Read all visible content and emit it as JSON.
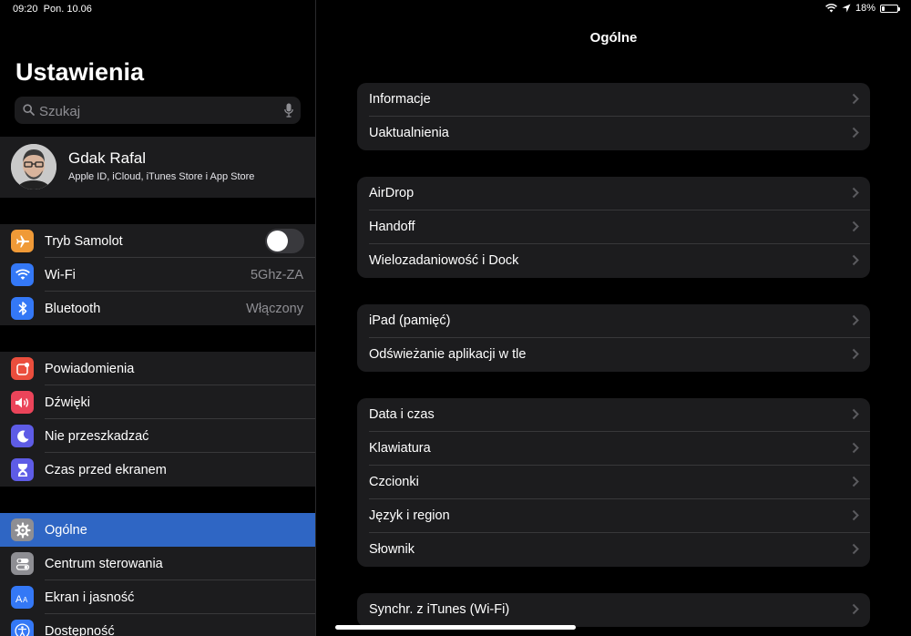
{
  "status": {
    "time": "09:20",
    "date": "Pon. 10.06",
    "battery_percent": "18%",
    "battery_level": 0.18
  },
  "sidebar": {
    "title": "Ustawienia",
    "search_placeholder": "Szukaj",
    "profile": {
      "name": "Gdak Rafal",
      "subtitle": "Apple ID, iCloud, iTunes Store i App Store"
    },
    "groups": [
      [
        {
          "label": "Tryb Samolot",
          "icon": "airplane-icon",
          "color": "#f09a37",
          "toggle": false
        },
        {
          "label": "Wi-Fi",
          "value": "5Ghz-ZA",
          "icon": "wifi-icon",
          "color": "#3478f6"
        },
        {
          "label": "Bluetooth",
          "value": "Włączony",
          "icon": "bluetooth-icon",
          "color": "#3478f6"
        }
      ],
      [
        {
          "label": "Powiadomienia",
          "icon": "notifications-icon",
          "color": "#eb4e3d"
        },
        {
          "label": "Dźwięki",
          "icon": "speaker-icon",
          "color": "#eb445a"
        },
        {
          "label": "Nie przeszkadzać",
          "icon": "moon-icon",
          "color": "#5e5ce6"
        },
        {
          "label": "Czas przed ekranem",
          "icon": "hourglass-icon",
          "color": "#5e5ce6"
        }
      ],
      [
        {
          "label": "Ogólne",
          "icon": "gear-icon",
          "color": "#8e8e93",
          "selected": true
        },
        {
          "label": "Centrum sterowania",
          "icon": "switches-icon",
          "color": "#8e8e93"
        },
        {
          "label": "Ekran i jasność",
          "icon": "text-size-icon",
          "color": "#3478f6"
        },
        {
          "label": "Dostępność",
          "icon": "accessibility-icon",
          "color": "#3478f6"
        }
      ]
    ]
  },
  "main": {
    "title": "Ogólne",
    "groups": [
      [
        "Informacje",
        "Uaktualnienia"
      ],
      [
        "AirDrop",
        "Handoff",
        "Wielozadaniowość i Dock"
      ],
      [
        "iPad (pamięć)",
        "Odświeżanie aplikacji w tle"
      ],
      [
        "Data i czas",
        "Klawiatura",
        "Czcionki",
        "Język i region",
        "Słownik"
      ],
      [
        "Synchr. z iTunes (Wi-Fi)"
      ]
    ]
  }
}
